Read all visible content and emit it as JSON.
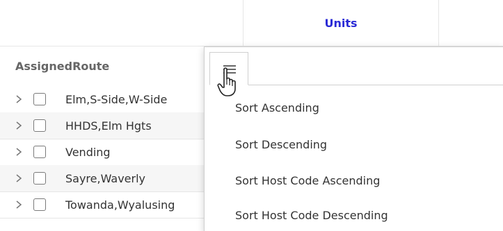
{
  "header": {
    "units_label": "Units",
    "assigned_route_label": "AssignedRoute"
  },
  "rows": [
    {
      "label": "Elm,S-Side,W-Side"
    },
    {
      "label": "HHDS,Elm Hgts"
    },
    {
      "label": "Vending"
    },
    {
      "label": "Sayre,Waverly"
    },
    {
      "label": "Towanda,Wyalusing"
    }
  ],
  "menu": {
    "tab_icon": "hamburger-menu-icon",
    "items": [
      {
        "label": "Sort Ascending"
      },
      {
        "label": "Sort Descending"
      },
      {
        "label": "Sort Host Code Ascending"
      },
      {
        "label": "Sort Host Code Descending"
      }
    ]
  },
  "cursor": "hand-pointer-icon",
  "colors": {
    "units_header": "#2b2bd6",
    "header_text": "#666666",
    "row_alt": "#f6f6f6",
    "border": "#e6e6e6"
  }
}
